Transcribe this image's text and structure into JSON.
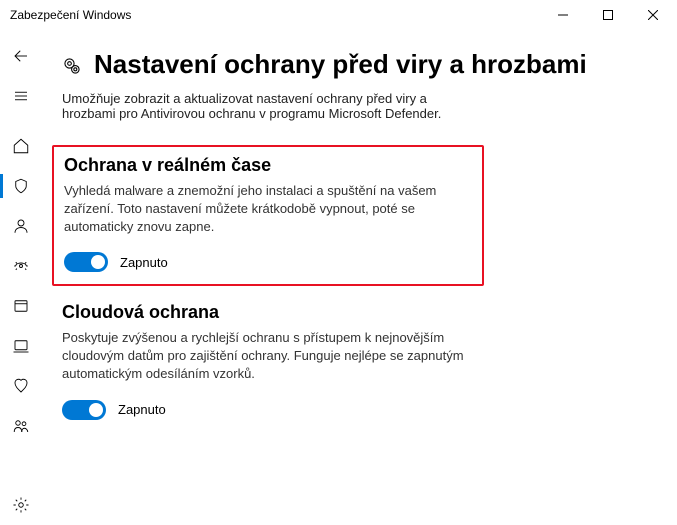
{
  "window": {
    "title": "Zabezpečení Windows"
  },
  "page": {
    "title": "Nastavení ochrany před viry a hrozbami",
    "description": "Umožňuje zobrazit a aktualizovat nastavení ochrany před viry a hrozbami pro Antivirovou ochranu v programu Microsoft Defender."
  },
  "sections": {
    "realtime": {
      "title": "Ochrana v reálném čase",
      "description": "Vyhledá malware a znemožní jeho instalaci a spuštění na vašem zařízení. Toto nastavení můžete krátkodobě vypnout, poté se automaticky znovu zapne.",
      "toggle_label": "Zapnuto",
      "on": true
    },
    "cloud": {
      "title": "Cloudová ochrana",
      "description": "Poskytuje zvýšenou a rychlejší ochranu s přístupem k nejnovějším cloudovým datům pro zajištění ochrany. Funguje nejlépe se zapnutým automatickým odesíláním vzorků.",
      "toggle_label": "Zapnuto",
      "on": true
    }
  },
  "colors": {
    "accent": "#0078d4",
    "highlight_border": "#e81123"
  }
}
